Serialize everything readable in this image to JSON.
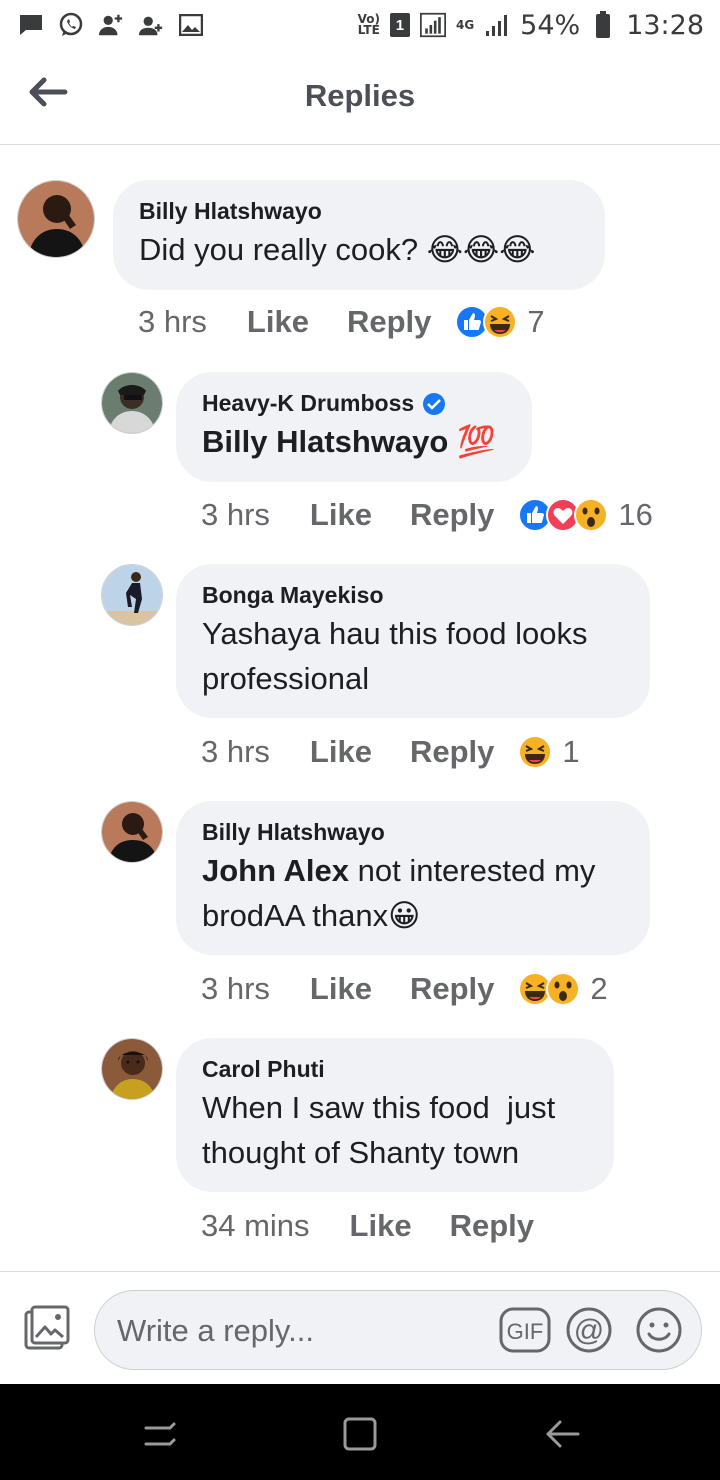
{
  "status_bar": {
    "volte_top": "Vo)",
    "volte_bottom": "LTE",
    "sim": "1",
    "network_top": "4G",
    "battery": "54%",
    "time": "13:28"
  },
  "header": {
    "title": "Replies"
  },
  "comments": [
    {
      "author": "Billy Hlatshwayo",
      "verified": false,
      "text": "Did you really cook?",
      "emojis": "😂😂😂",
      "time": "3 hrs",
      "like": "Like",
      "reply": "Reply",
      "reactions": [
        "like",
        "haha"
      ],
      "reaction_count": "7"
    },
    {
      "author": "Heavy-K Drumboss",
      "verified": true,
      "mention": "Billy Hlatshwayo",
      "text": "",
      "emojis": "💯",
      "time": "3 hrs",
      "like": "Like",
      "reply": "Reply",
      "reactions": [
        "like",
        "love",
        "wow"
      ],
      "reaction_count": "16"
    },
    {
      "author": "Bonga Mayekiso",
      "verified": false,
      "text_line1": "Yashaya hau this food looks",
      "text_line2": "professional",
      "time": "3 hrs",
      "like": "Like",
      "reply": "Reply",
      "reactions": [
        "haha"
      ],
      "reaction_count": "1"
    },
    {
      "author": "Billy Hlatshwayo",
      "verified": false,
      "mention": "John Alex",
      "text_line1": " not interested my",
      "text_line2": "brodAA thanx",
      "emojis": "😀",
      "time": "3 hrs",
      "like": "Like",
      "reply": "Reply",
      "reactions": [
        "haha",
        "wow"
      ],
      "reaction_count": "2"
    },
    {
      "author": "Carol Phuti",
      "verified": false,
      "text_line1": "When I saw this food  just",
      "text_line2": "thought of Shanty town",
      "time": "34 mins",
      "like": "Like",
      "reply": "Reply"
    }
  ],
  "composer": {
    "placeholder": "Write a reply...",
    "gif_label": "GIF",
    "mention_label": "@"
  },
  "colors": {
    "bubble": "#f0f2f5",
    "meta_text": "#65676b",
    "like_blue": "#1877f2",
    "love_red": "#f33e58",
    "emoji_yellow": "#f7b125",
    "nav_bar": "#000000"
  }
}
